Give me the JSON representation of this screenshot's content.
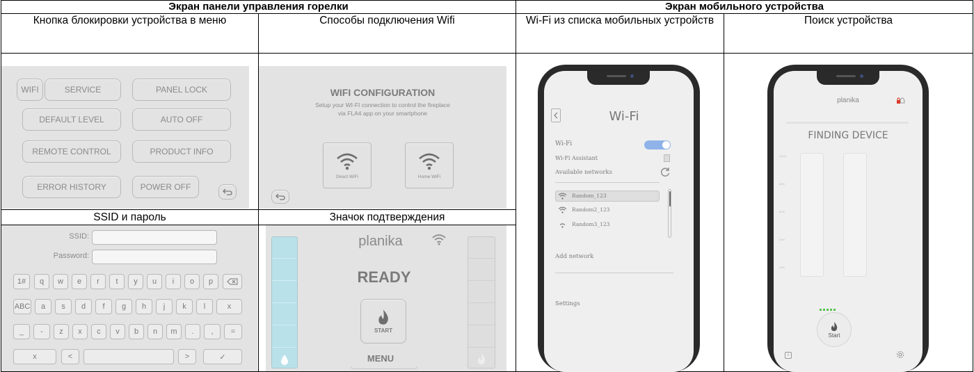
{
  "headers": {
    "burner_panel": "Экран панели управления горелки",
    "mobile": "Экран мобильного устройства"
  },
  "captions": {
    "lock_menu": "Кнопка блокировки устройства в меню",
    "wifi_methods": "Способы подключения Wifi",
    "ssid_password": "SSID и пароль",
    "confirm_icon": "Значок подтверждения",
    "wifi_list": "Wi-Fi из списка мобильных устройств",
    "device_search": "Поиск устройства"
  },
  "menu_panel": {
    "buttons": [
      "WIFI",
      "SERVICE",
      "PANEL LOCK",
      "DEFAULT LEVEL",
      "AUTO OFF",
      "REMOTE CONTROL",
      "PRODUCT INFO",
      "ERROR HISTORY",
      "POWER OFF"
    ]
  },
  "wifi_panel": {
    "title": "WIFI CONFIGURATION",
    "subtitle_line1": "Setup your WI-FI connection to control the fireplace",
    "subtitle_line2": "via FLA4 app on your smartphone",
    "direct_label": "Direct WiFi",
    "home_label": "Home WiFi"
  },
  "ssid_panel": {
    "ssid_label": "SSID:",
    "password_label": "Password:",
    "row1": [
      "1#",
      "q",
      "w",
      "e",
      "r",
      "t",
      "y",
      "u",
      "i",
      "o",
      "p"
    ],
    "row2": [
      "ABC",
      "a",
      "s",
      "d",
      "f",
      "g",
      "h",
      "j",
      "k",
      "l",
      "x"
    ],
    "row3": [
      "_",
      "-",
      "z",
      "x",
      "c",
      "v",
      "b",
      "n",
      "m",
      ".",
      ",",
      "="
    ],
    "row4": [
      "x",
      "<",
      "",
      ">",
      "✓"
    ]
  },
  "ready_panel": {
    "brand": "planika",
    "status": "READY",
    "start_label": "START",
    "menu_label": "MENU"
  },
  "phone_wifi": {
    "title": "Wi-Fi",
    "wifi_label": "Wi-Fi",
    "assistant_label": "Wi-Fi Assistant",
    "available_label": "Available networks",
    "networks": [
      "Random_123",
      "Random2_123",
      "Random3_123"
    ],
    "add_network": "Add network",
    "settings": "Settings"
  },
  "phone_find": {
    "brand": "planika",
    "status": "FINDING DEVICE",
    "scale": [
      "100%",
      "80%",
      "60%",
      "40%",
      "20%"
    ],
    "start_label": "Start"
  },
  "colors": {
    "panel_bg": "#e3e3e3",
    "toggle_blue": "#8fb3e8",
    "flame_blue": "#b9e1ea",
    "dots_green": "#59c24f",
    "lock_red": "#d83a2a"
  }
}
